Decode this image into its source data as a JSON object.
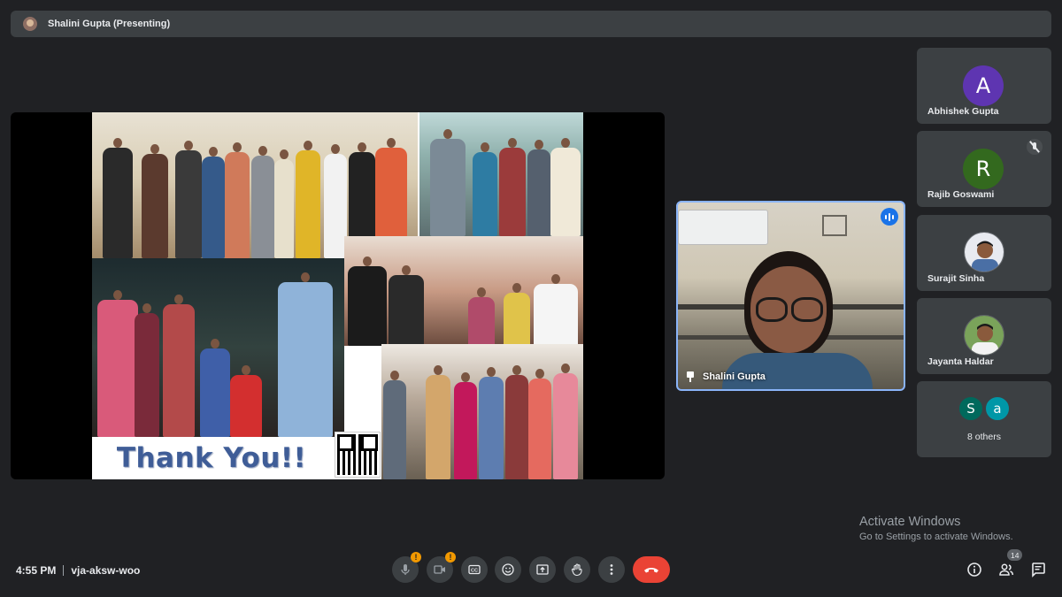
{
  "header": {
    "presenter_label": "Shalini Gupta (Presenting)",
    "avatar_icon": "presenter-avatar"
  },
  "presentation": {
    "thank_you_text": "Thank You!!",
    "qr_icon": "qr-code"
  },
  "self_view": {
    "name": "Shalini Gupta",
    "speaking_icon": "speaking-indicator-icon",
    "pin_icon": "pin-icon"
  },
  "participants": [
    {
      "name": "Abhishek Gupta",
      "initial": "A",
      "color": "#5e35b1",
      "muted": false
    },
    {
      "name": "Rajib Goswami",
      "initial": "R",
      "color": "#33691e",
      "muted": true
    },
    {
      "name": "Surajit Sinha",
      "initial": "",
      "photo": true,
      "muted": false
    },
    {
      "name": "Jayanta Haldar",
      "initial": "",
      "photo": true,
      "muted": false
    }
  ],
  "others": {
    "label": "8 others",
    "avatars": [
      {
        "initial": "S",
        "color": "#00695c"
      },
      {
        "initial": "a",
        "color": "#0097a7"
      }
    ]
  },
  "watermark": {
    "line1": "Activate Windows",
    "line2": "Go to Settings to activate Windows."
  },
  "bottom_bar": {
    "time": "4:55 PM",
    "meeting_code": "vja-aksw-woo",
    "mic_badge": "!",
    "camera_badge": "!",
    "people_count": "14",
    "controls": [
      "microphone-icon",
      "camera-icon",
      "captions-icon",
      "emoji-icon",
      "present-icon",
      "raise-hand-icon",
      "more-options-icon",
      "end-call-icon"
    ],
    "right_controls": [
      "info-icon",
      "people-icon",
      "chat-icon"
    ]
  }
}
